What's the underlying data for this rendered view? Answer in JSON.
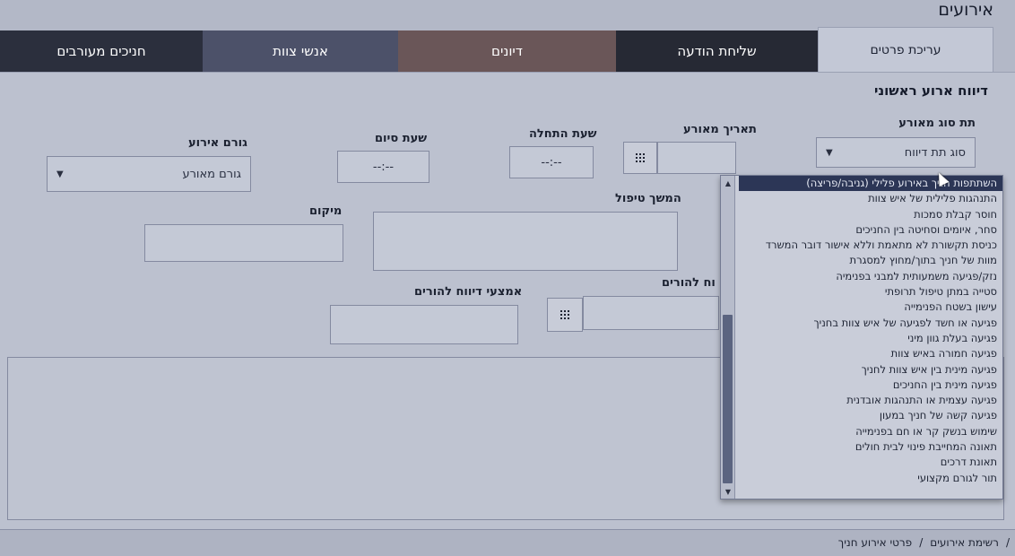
{
  "page": {
    "title": "אירועים"
  },
  "tabs": [
    {
      "label": "עריכת פרטים",
      "active": true
    },
    {
      "label": "חניכים מעורבים",
      "color": "#2b2f3d"
    },
    {
      "label": "אנשי צוות",
      "color": "#4c5169"
    },
    {
      "label": "דיונים",
      "color": "#6a5658"
    },
    {
      "label": "שליחת הודעה",
      "color": "#262934"
    }
  ],
  "form": {
    "section_title": "דיווח ארוע ראשוני",
    "subtype_label": "תת סוג מאורע",
    "subtype_value": "סוג תת דיווח",
    "date_label": "תאריך מאורע",
    "start_label": "שעת התחלה",
    "start_value": "--:--",
    "end_label": "שעת סיום",
    "end_value": "--:--",
    "cause_label": "גורם אירוע",
    "cause_value": "גורם מאורע",
    "followup_label": "המשך טיפול",
    "location_label": "מיקום",
    "parents_report_label": "וח להורים",
    "parents_means_label": "אמצעי דיווח להורים"
  },
  "dropdown": {
    "selected_index": 0,
    "options": [
      "השתתפות חניך באירוע פלילי (גניבה/פריצה)",
      "התנהגות פלילית של איש צוות",
      "חוסר קבלת סמכות",
      "סחר, איומים וסחיטה בין החניכים",
      "כניסת תקשורת לא מתאמת וללא אישור דובר המשרד",
      "מוות של חניך בתוך/מחוץ למסגרת",
      "נזק/פגיעה משמעותית למבני בפנימיה",
      "סטייה במתן טיפול תרופתי",
      "עישון בשטח הפנימייה",
      "פגיעה או חשד לפגיעה של איש צוות בחניך",
      "פגיעה בעלת גוון מיני",
      "פגיעה חמורה באיש צוות",
      "פגיעה מינית בין איש צוות לחניך",
      "פגיעה מינית בין החניכים",
      "פגיעה עצמית או התנהגות אובדנית",
      "פגיעה קשה של חניך במעון",
      "שימוש בנשק קר או חם בפנימייה",
      "תאונה המחייבת פינוי לבית חולים",
      "תאונת דרכים",
      "תור לגורם מקצועי"
    ]
  },
  "footer": {
    "links": [
      "רשימת אירועים",
      "פרטי אירוע חניך"
    ],
    "separator": "/"
  }
}
